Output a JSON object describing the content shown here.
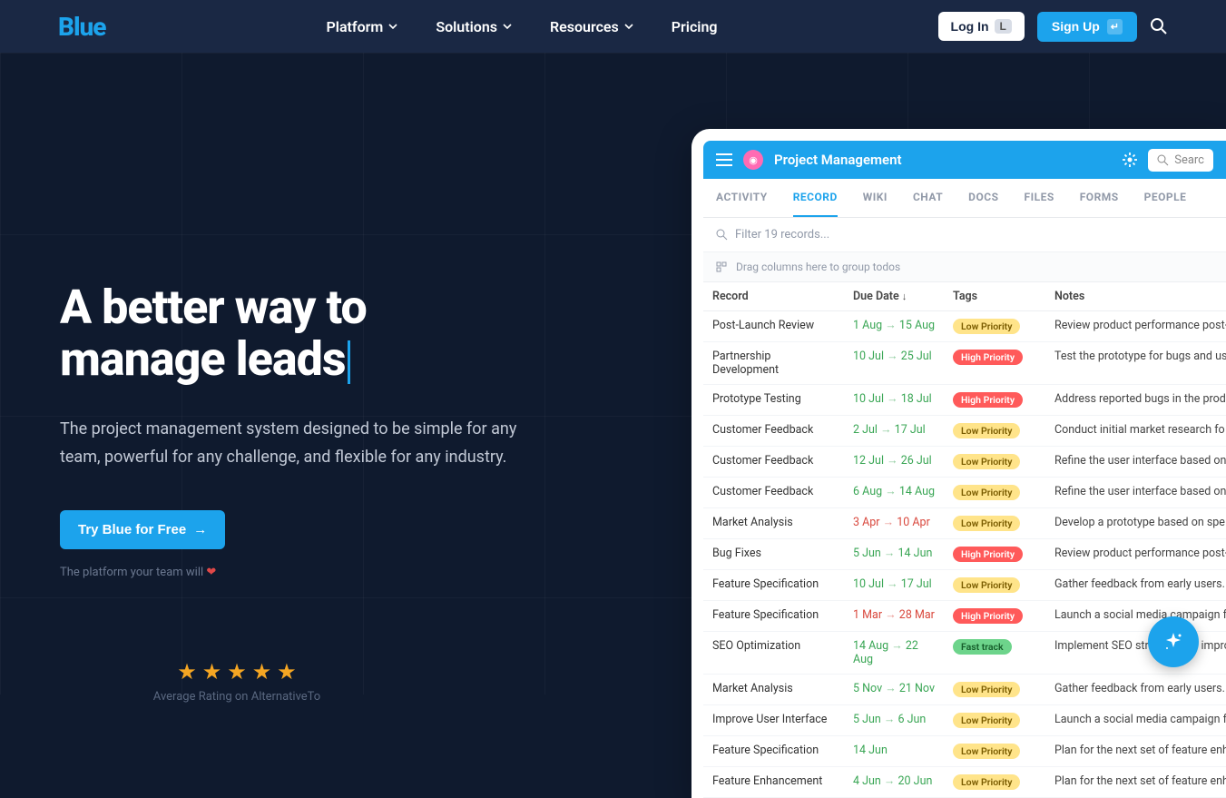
{
  "brand": "Blue",
  "nav": {
    "platform": "Platform",
    "solutions": "Solutions",
    "resources": "Resources",
    "pricing": "Pricing",
    "login": "Log In",
    "login_key": "L",
    "signup": "Sign Up"
  },
  "hero": {
    "title_l1": "A better way to",
    "title_l2": "manage leads",
    "sub": "The project management system designed to be simple for any team, powerful for any challenge, and flexible for any industry.",
    "cta": "Try Blue for Free",
    "tagline": "The platform your team will",
    "rating_text": "Average Rating on AlternativeTo"
  },
  "app": {
    "title": "Project Management",
    "search_placeholder": "Searc",
    "tabs": [
      "ACTIVITY",
      "RECORD",
      "WIKI",
      "CHAT",
      "DOCS",
      "FILES",
      "FORMS",
      "PEOPLE"
    ],
    "active_tab": "RECORD",
    "filter_placeholder": "Filter 19 records...",
    "group_hint": "Drag columns here to group todos",
    "columns": {
      "record": "Record",
      "due": "Due Date",
      "tags": "Tags",
      "notes": "Notes"
    },
    "rows": [
      {
        "rec": "Post-Launch Review",
        "d1": "1 Aug",
        "d2": "15 Aug",
        "dc": "g",
        "tag": "Low Priority",
        "tc": "low",
        "note": "Review product performance post-"
      },
      {
        "rec": "Partnership Development",
        "d1": "10 Jul",
        "d2": "25 Jul",
        "dc": "g",
        "tag": "High Priority",
        "tc": "high",
        "note": "Test the prototype for bugs and us"
      },
      {
        "rec": "Prototype Testing",
        "d1": "10 Jul",
        "d2": "18 Jul",
        "dc": "g",
        "tag": "High Priority",
        "tc": "high",
        "note": "Address reported bugs in the prod"
      },
      {
        "rec": "Customer Feedback",
        "d1": "2 Jul",
        "d2": "17 Jul",
        "dc": "g",
        "tag": "Low Priority",
        "tc": "low",
        "note": "Conduct initial market research fo"
      },
      {
        "rec": "Customer Feedback",
        "d1": "12 Jul",
        "d2": "26 Jul",
        "dc": "g",
        "tag": "Low Priority",
        "tc": "low",
        "note": "Refine the user interface based on"
      },
      {
        "rec": "Customer Feedback",
        "d1": "6 Aug",
        "d2": "14 Aug",
        "dc": "g",
        "tag": "Low Priority",
        "tc": "low",
        "note": "Refine the user interface based on"
      },
      {
        "rec": "Market Analysis",
        "d1": "3 Apr",
        "d2": "10 Apr",
        "dc": "r",
        "tag": "Low Priority",
        "tc": "low",
        "note": "Develop a prototype based on spe"
      },
      {
        "rec": "Bug Fixes",
        "d1": "5 Jun",
        "d2": "14 Jun",
        "dc": "g",
        "tag": "High Priority",
        "tc": "high",
        "note": "Review product performance post-"
      },
      {
        "rec": "Feature Specification",
        "d1": "10 Jul",
        "d2": "17 Jul",
        "dc": "g",
        "tag": "Low Priority",
        "tc": "low",
        "note": "Gather feedback from early users."
      },
      {
        "rec": "Feature Specification",
        "d1": "1 Mar",
        "d2": "28 Mar",
        "dc": "r",
        "tag": "High Priority",
        "tc": "high",
        "note": "Launch a social media campaign fo"
      },
      {
        "rec": "SEO Optimization",
        "d1": "14 Aug",
        "d2": "22 Aug",
        "dc": "g",
        "tag": "Fast track",
        "tc": "fast",
        "note": "Implement SEO strategies to impro"
      },
      {
        "rec": "Market Analysis",
        "d1": "5 Nov",
        "d2": "21 Nov",
        "dc": "g",
        "tag": "Low Priority",
        "tc": "low",
        "note": "Gather feedback from early users."
      },
      {
        "rec": "Improve User Interface",
        "d1": "5 Jun",
        "d2": "6 Jun",
        "dc": "g",
        "tag": "Low Priority",
        "tc": "low",
        "note": "Launch a social media campaign fo"
      },
      {
        "rec": "Feature Specification",
        "d1": "14 Jun",
        "d2": "",
        "dc": "g",
        "tag": "Low Priority",
        "tc": "low",
        "note": "Plan for the next set of feature enh"
      },
      {
        "rec": "Feature Enhancement",
        "d1": "4 Jun",
        "d2": "20 Jun",
        "dc": "g",
        "tag": "Low Priority",
        "tc": "low",
        "note": "Plan for the next set of feature enh"
      }
    ]
  }
}
